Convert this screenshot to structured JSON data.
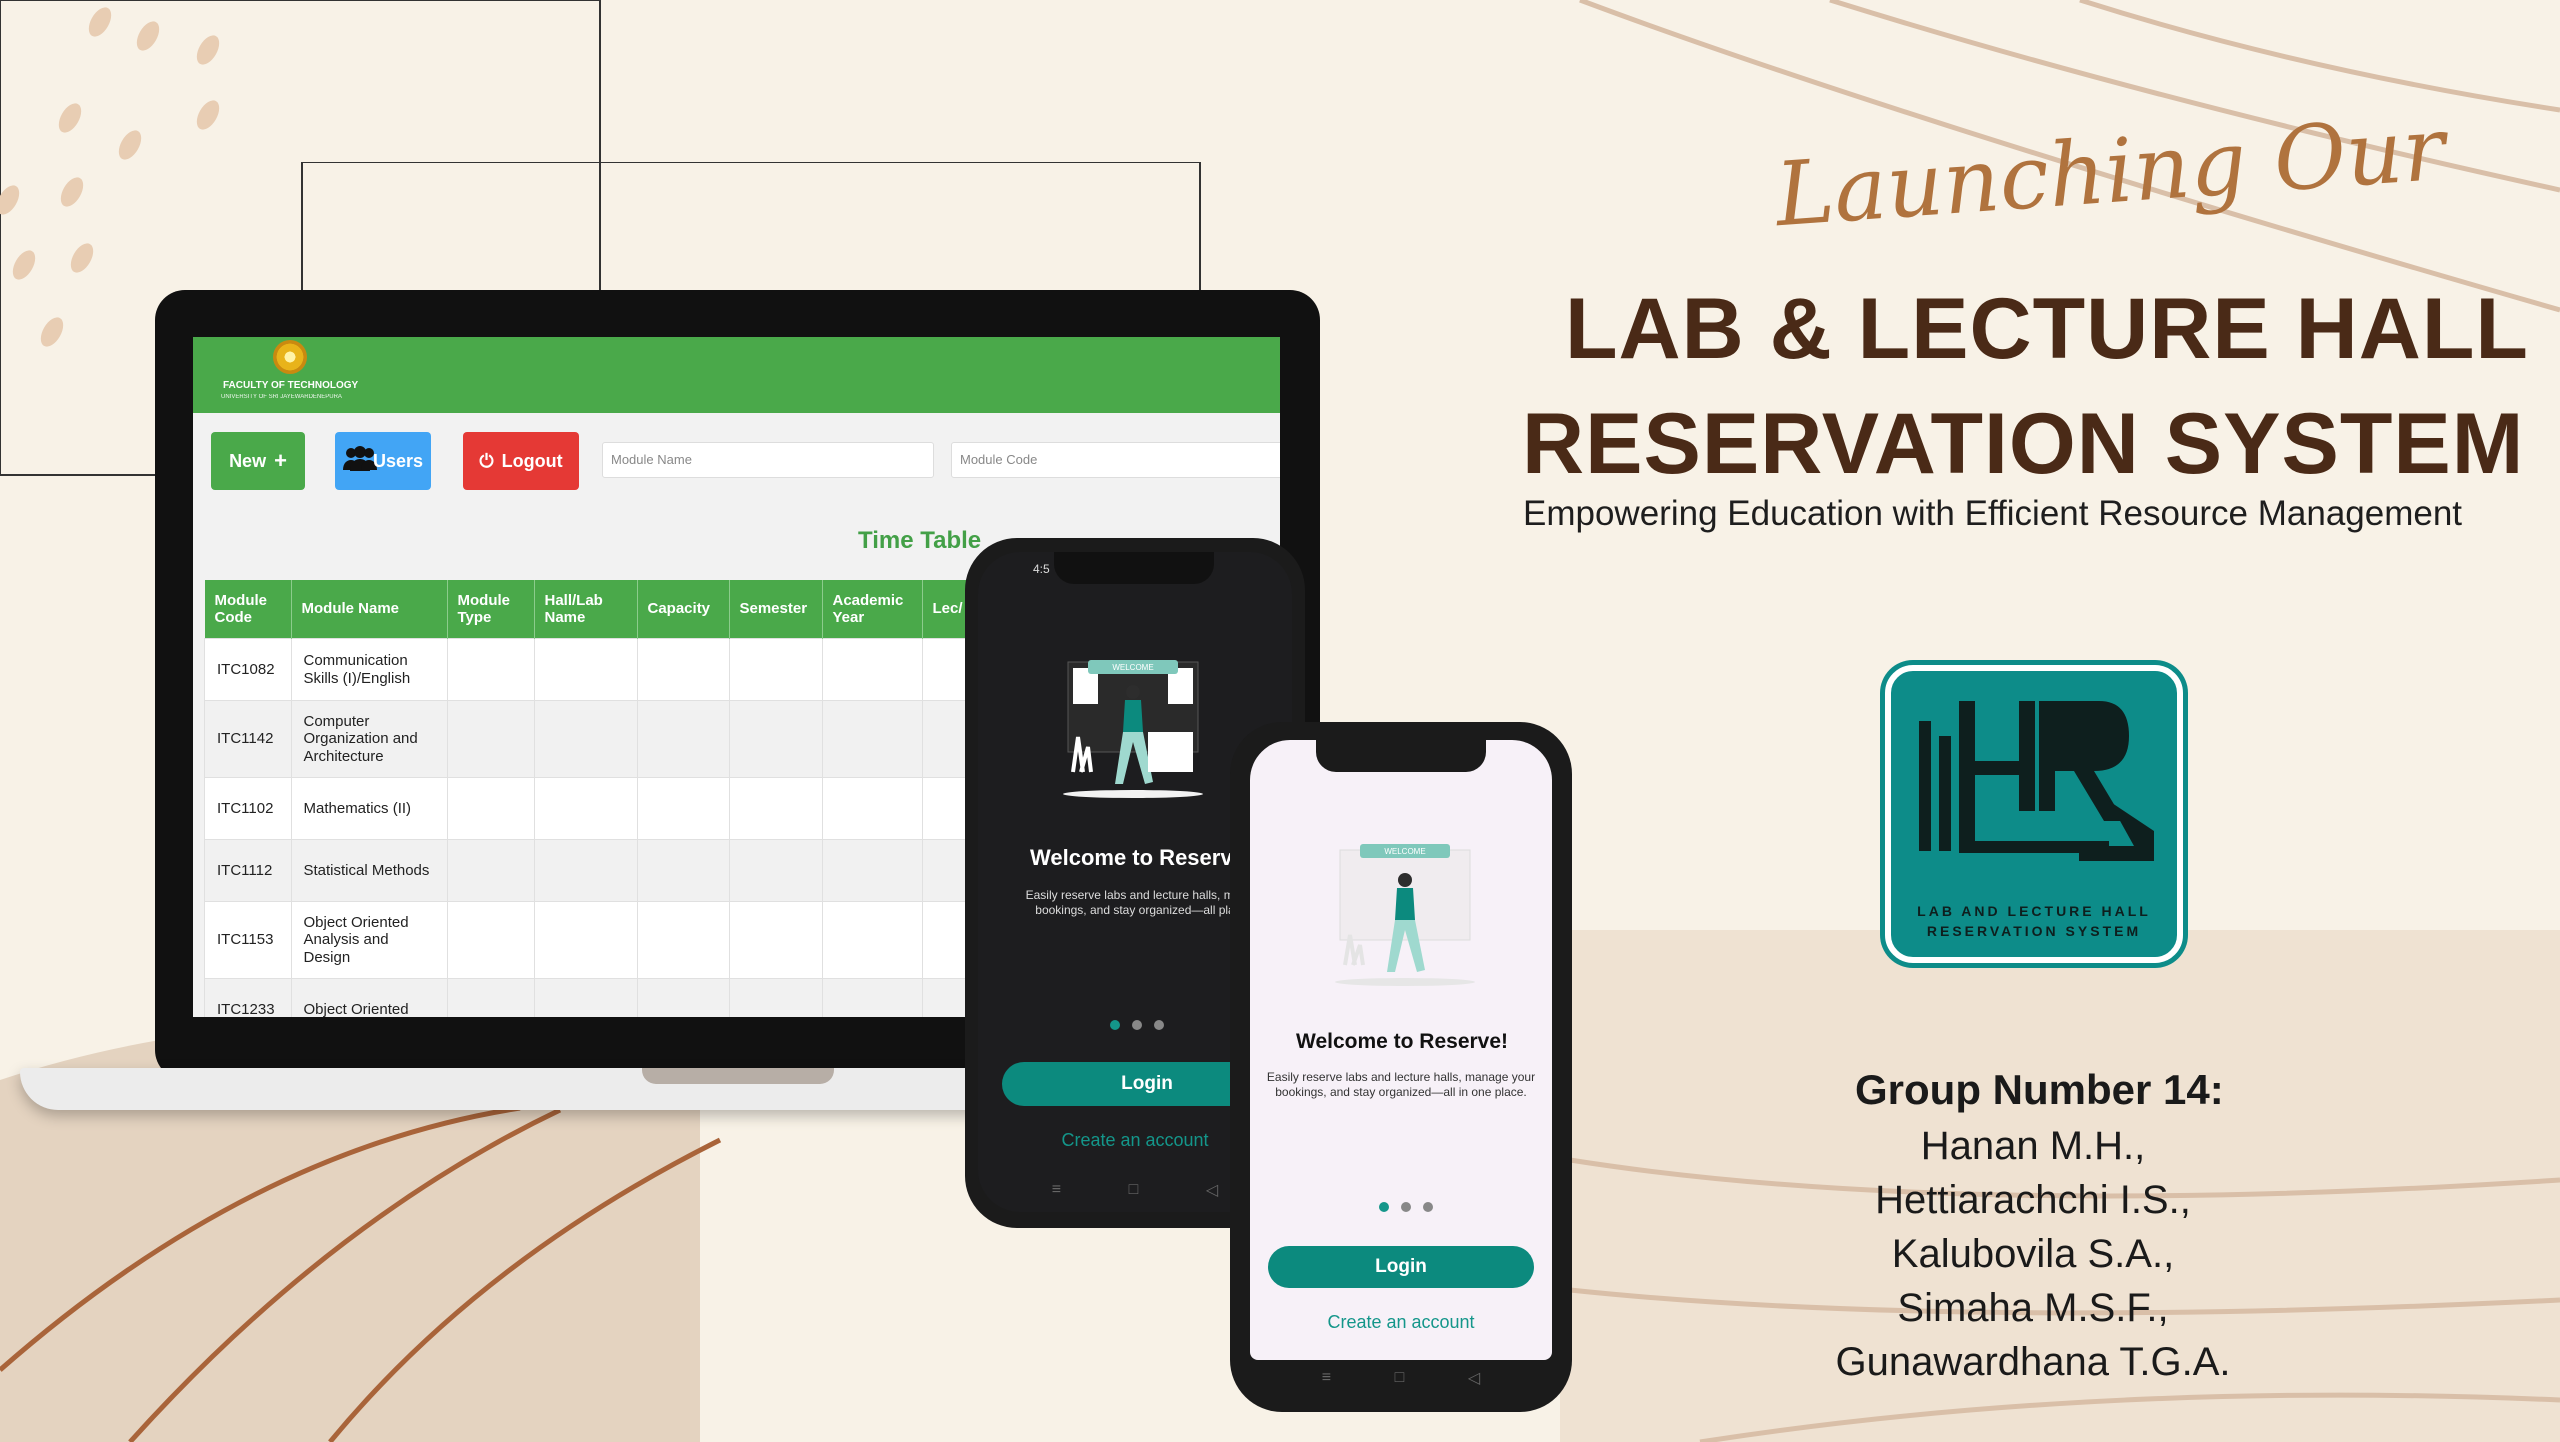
{
  "laptop_app": {
    "faculty_name": "FACULTY OF TECHNOLOGY",
    "university": "UNIVERSITY OF SRI JAYEWARDENEPURA",
    "buttons": {
      "new": "New",
      "users": "Users",
      "logout": "Logout"
    },
    "search": {
      "module_name_placeholder": "Module Name",
      "module_code_placeholder": "Module Code"
    },
    "timetable_title": "Time Table",
    "columns": [
      "Module Code",
      "Module Name",
      "Module Type",
      "Hall/Lab Name",
      "Capacity",
      "Semester",
      "Academic Year",
      "Lec/"
    ],
    "rows": [
      {
        "code": "ITC1082",
        "name": "Communication Skills (I)/English"
      },
      {
        "code": "ITC1142",
        "name": "Computer Organization and Architecture"
      },
      {
        "code": "ITC1102",
        "name": "Mathematics (II)"
      },
      {
        "code": "ITC1112",
        "name": "Statistical Methods"
      },
      {
        "code": "ITC1153",
        "name": "Object Oriented Analysis and Design"
      },
      {
        "code": "ITC1233",
        "name": "Object Oriented"
      }
    ]
  },
  "phone_dark": {
    "time": "4:5",
    "welcome_title": "Welcome to Reserve",
    "welcome_text": "Easily reserve labs and lecture halls, m your bookings, and stay organized—all place.",
    "login": "Login",
    "create_account": "Create an account"
  },
  "phone_light": {
    "welcome_title": "Welcome to Reserve!",
    "welcome_text": "Easily reserve labs and lecture halls, manage your bookings, and stay organized—all in one place.",
    "login": "Login",
    "create_account": "Create an account"
  },
  "illustration": {
    "banner": "WELCOME"
  },
  "headline": {
    "script": "Launching Our",
    "line1": "LAB & LECTURE HALL",
    "line2": "RESERVATION SYSTEM",
    "tagline": "Empowering Education with Efficient Resource Management"
  },
  "logo": {
    "line1": "LAB AND LECTURE HALL",
    "line2": "RESERVATION SYSTEM"
  },
  "group": {
    "title": "Group Number 14:",
    "members": [
      "Hanan M.H.,",
      "Hettiarachchi I.S.,",
      "Kalubovila S.A.,",
      "Simaha M.S.F.,",
      "Gunawardhana T.G.A."
    ]
  },
  "colors": {
    "accent_green": "#4aa94a",
    "teal": "#0c8a7e",
    "brown": "#4a2a17",
    "background": "#f8f2e7"
  }
}
